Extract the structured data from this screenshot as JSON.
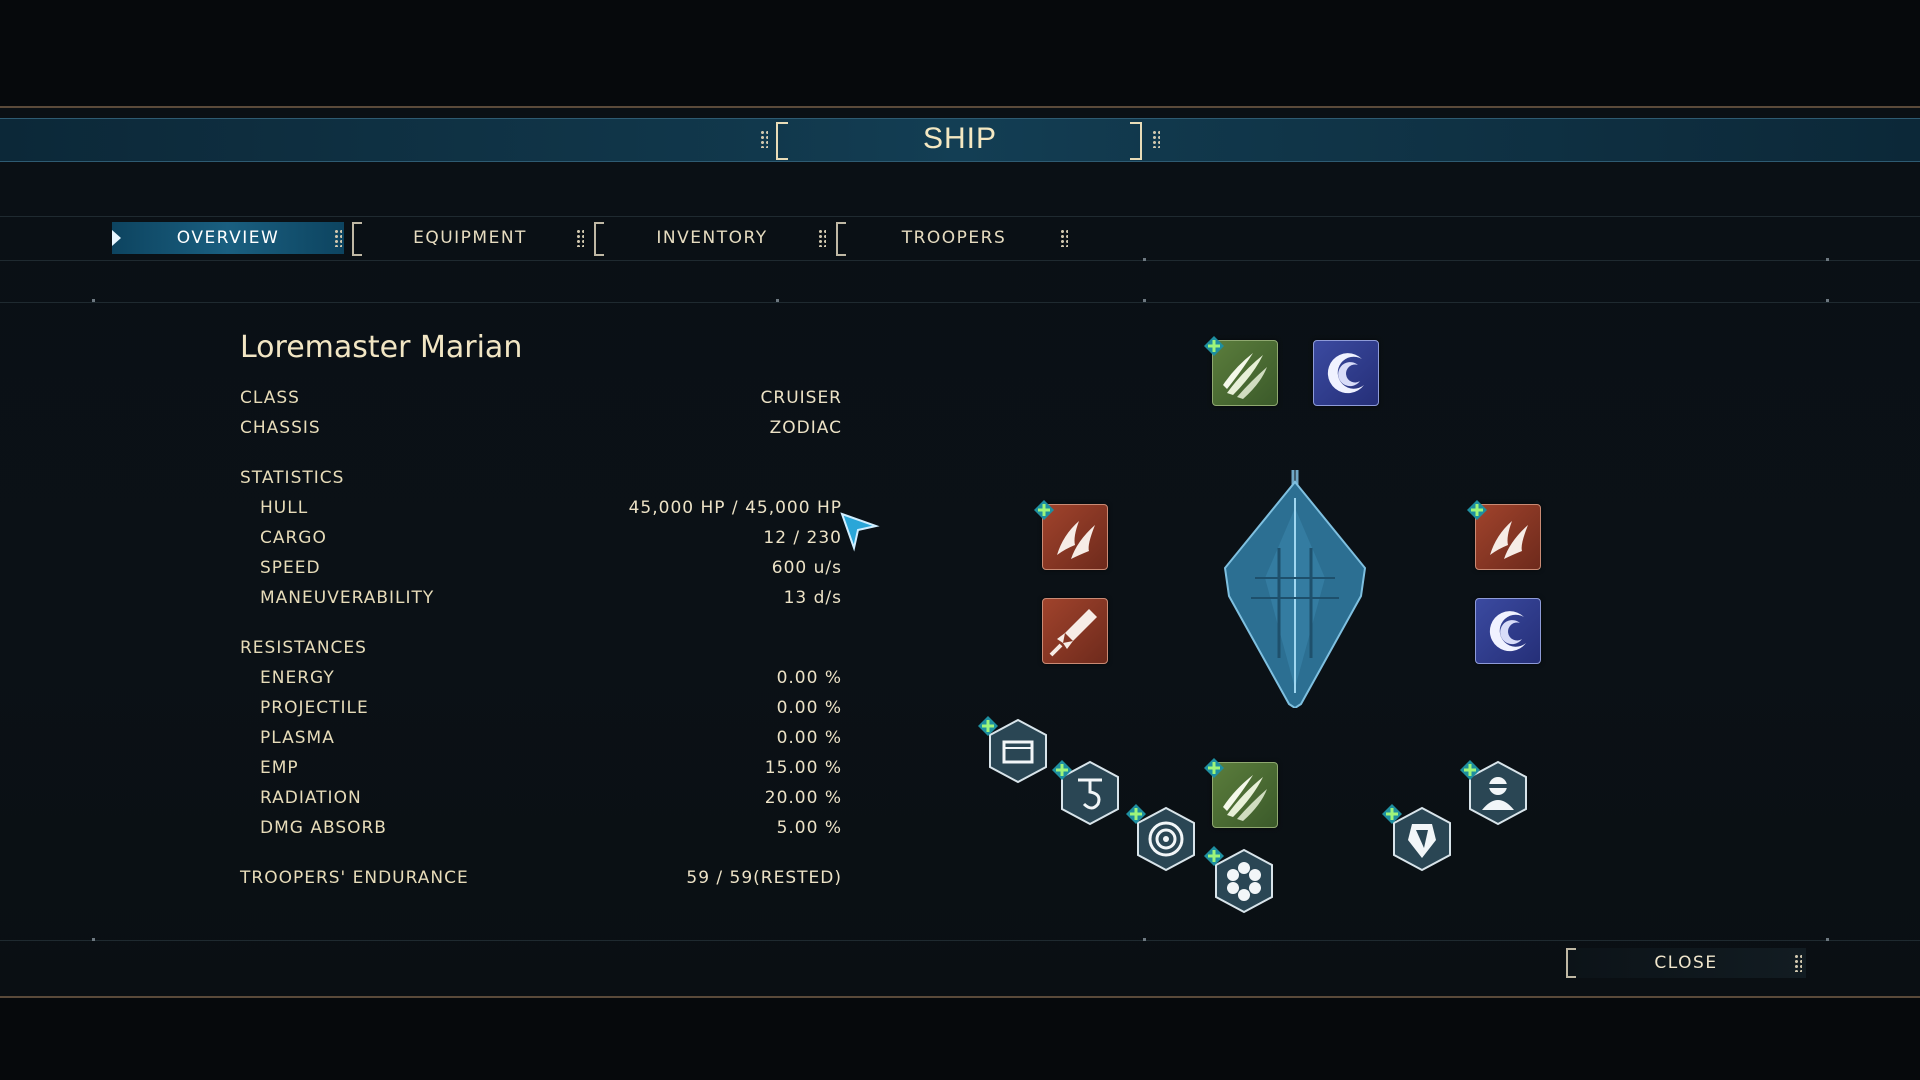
{
  "header": {
    "title": "SHIP"
  },
  "tabs": [
    {
      "label": "OVERVIEW",
      "active": true
    },
    {
      "label": "EQUIPMENT",
      "active": false
    },
    {
      "label": "INVENTORY",
      "active": false
    },
    {
      "label": "TROOPERS",
      "active": false
    }
  ],
  "ship": {
    "name": "Loremaster Marian",
    "class_label": "CLASS",
    "class_value": "CRUISER",
    "chassis_label": "CHASSIS",
    "chassis_value": "ZODIAC",
    "statistics_label": "STATISTICS",
    "stats": [
      {
        "label": "HULL",
        "value": "45,000 HP / 45,000 HP"
      },
      {
        "label": "CARGO",
        "value": "12 / 230"
      },
      {
        "label": "SPEED",
        "value": "600 u/s"
      },
      {
        "label": "MANEUVERABILITY",
        "value": "13 d/s"
      }
    ],
    "resistances_label": "RESISTANCES",
    "resistances": [
      {
        "label": "ENERGY",
        "value": "0.00 %"
      },
      {
        "label": "PROJECTILE",
        "value": "0.00 %"
      },
      {
        "label": "PLASMA",
        "value": "0.00 %"
      },
      {
        "label": "EMP",
        "value": "15.00 %"
      },
      {
        "label": "RADIATION",
        "value": "20.00 %"
      },
      {
        "label": "DMG ABSORB",
        "value": "5.00 %"
      }
    ],
    "endurance_label": "TROOPERS' ENDURANCE",
    "endurance_value": "59 / 59(RESTED)"
  },
  "slots": {
    "top_left": {
      "icon": "claw-icon",
      "color": "#4d6e34"
    },
    "top_right": {
      "icon": "crescent-icon",
      "color": "#2e3a8a"
    },
    "left_upper": {
      "icon": "flame-icon",
      "color": "#8a3a26"
    },
    "left_lower": {
      "icon": "rocket-icon",
      "color": "#8a3a26"
    },
    "right_upper": {
      "icon": "flame-icon",
      "color": "#8a3a26"
    },
    "right_lower": {
      "icon": "crescent-icon",
      "color": "#2e3a8a"
    },
    "bottom_center": {
      "icon": "claw-icon",
      "color": "#4d6e34"
    },
    "modules": [
      "cargo-module-icon",
      "hook-module-icon",
      "radar-module-icon",
      "honeycomb-module-icon",
      "shield-module-icon",
      "trooper-module-icon"
    ]
  },
  "footer": {
    "close_label": "CLOSE"
  }
}
